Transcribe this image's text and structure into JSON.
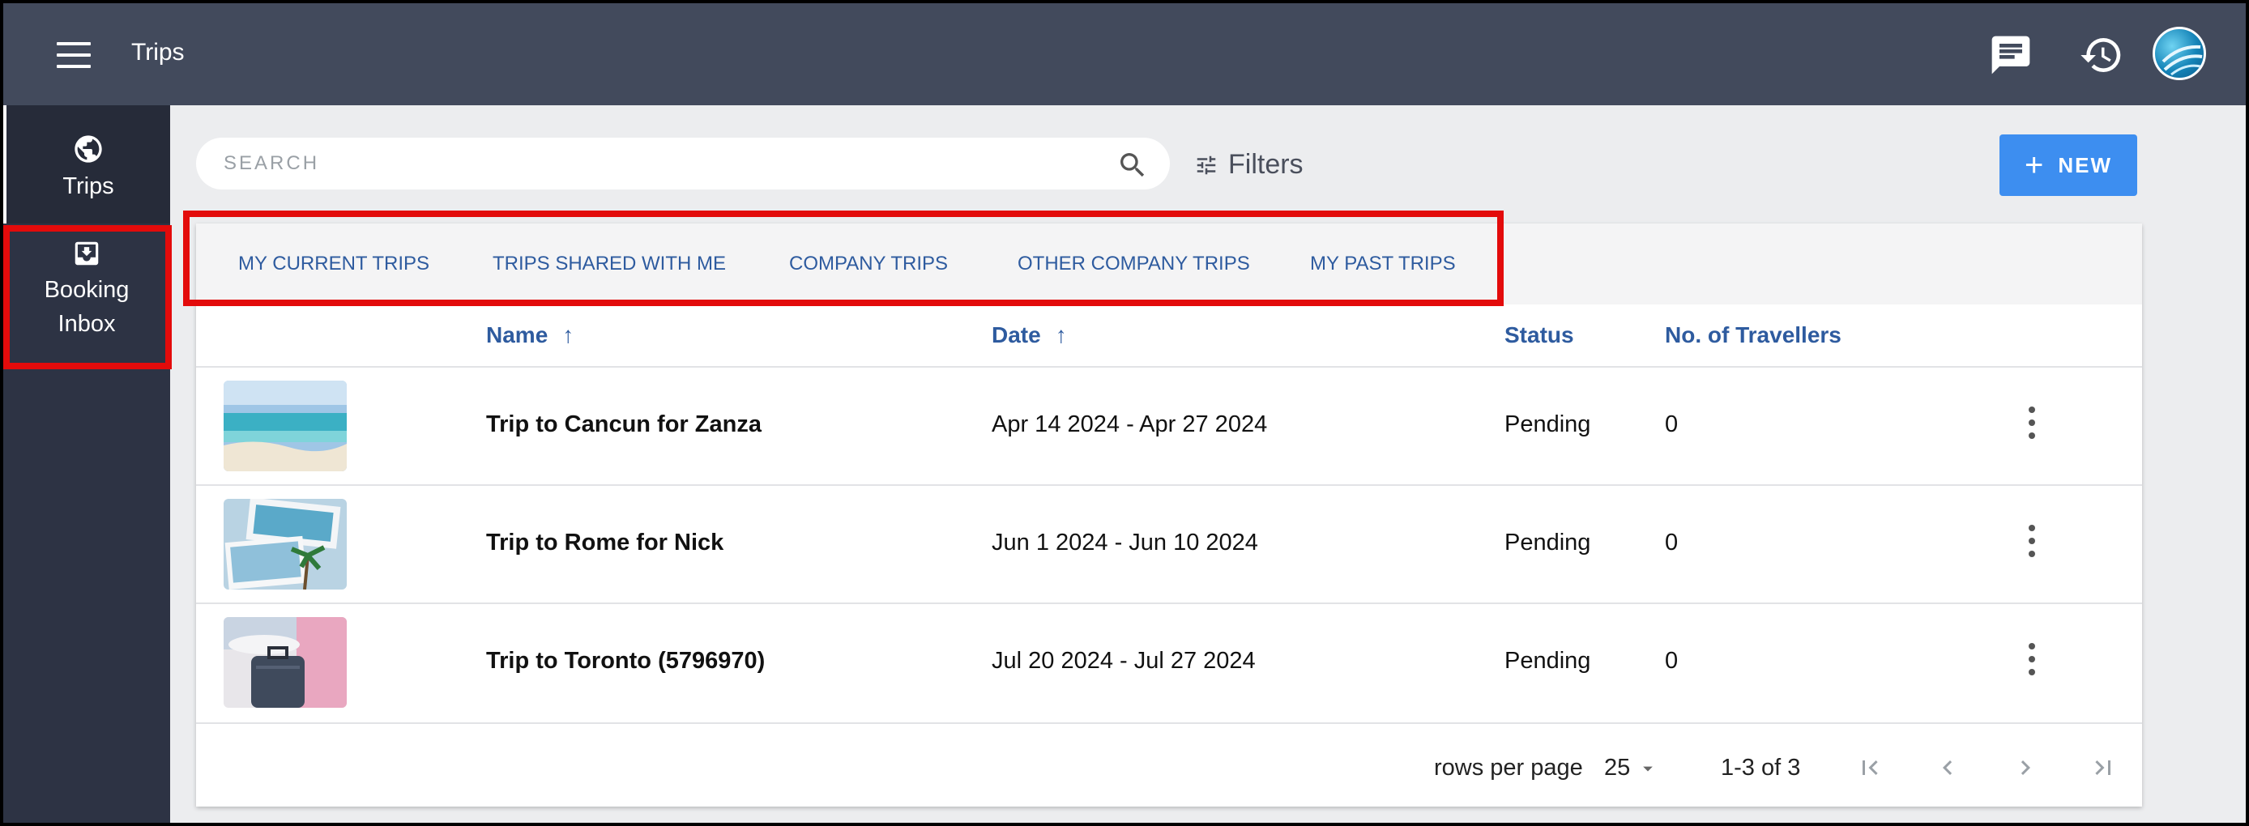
{
  "app": {
    "title": "Trips"
  },
  "header_icons": [
    "menu-icon",
    "chat-icon",
    "history-icon",
    "avatar"
  ],
  "sidebar": {
    "items": [
      {
        "label": "Trips",
        "icon": "globe-icon",
        "active": true
      },
      {
        "label_line1": "Booking",
        "label_line2": "Inbox",
        "icon": "inbox-download-icon",
        "active": false
      }
    ]
  },
  "search": {
    "placeholder": "SEARCH"
  },
  "filters": {
    "label": "Filters"
  },
  "new_button": {
    "label": "NEW"
  },
  "tabs": [
    "MY CURRENT TRIPS",
    "TRIPS SHARED WITH ME",
    "COMPANY TRIPS",
    "OTHER COMPANY TRIPS",
    "MY PAST TRIPS"
  ],
  "columns": {
    "name": "Name",
    "date": "Date",
    "status": "Status",
    "travellers": "No. of Travellers"
  },
  "rows": [
    {
      "name": "Trip to Cancun for Zanza",
      "date": "Apr 14 2024 - Apr 27 2024",
      "status": "Pending",
      "travellers": "0",
      "thumb": "beach"
    },
    {
      "name": "Trip to Rome for Nick",
      "date": "Jun 1 2024 - Jun 10 2024",
      "status": "Pending",
      "travellers": "0",
      "thumb": "postcards"
    },
    {
      "name": "Trip to Toronto (5796970)",
      "date": "Jul 20 2024 - Jul 27 2024",
      "status": "Pending",
      "travellers": "0",
      "thumb": "suitcase"
    }
  ],
  "pagination": {
    "rows_per_page_label": "rows per page",
    "rows_per_page": "25",
    "range": "1-3 of 3"
  },
  "colors": {
    "topbar": "#424a5c",
    "sidebar": "#2d3344",
    "accent": "#3d8ef0",
    "link": "#2e5b9f",
    "highlight": "#e30b0b"
  }
}
